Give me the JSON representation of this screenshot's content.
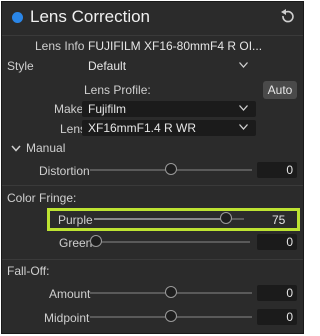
{
  "panel": {
    "title": "Lens Correction",
    "accent_color": "#2a86e8",
    "highlight_color": "#bde332",
    "icons": [
      "status-dot-icon",
      "reset-icon",
      "chevron-down-icon",
      "caret-down-icon"
    ]
  },
  "lens_info": {
    "label": "Lens Info",
    "value": "FUJIFILM XF16-80mmF4 R OI..."
  },
  "style": {
    "label": "Style",
    "value": "Default"
  },
  "lens_profile": {
    "label": "Lens Profile:",
    "auto_label": "Auto",
    "make_label": "Make",
    "make_value": "Fujifilm",
    "lens_label": "Lens",
    "lens_value": "XF16mmF1.4 R WR"
  },
  "manual": {
    "label": "Manual",
    "distortion_label": "Distortion",
    "distortion_value": "0",
    "distortion_level": 0.5
  },
  "color_fringe": {
    "label": "Color Fringe:",
    "purple_label": "Purple",
    "purple_value": "75",
    "purple_level": 0.88,
    "green_label": "Green",
    "green_value": "0",
    "green_level": 0.0
  },
  "fall_off": {
    "label": "Fall-Off:",
    "amount_label": "Amount",
    "amount_value": "0",
    "amount_level": 0.5,
    "midpoint_label": "Midpoint",
    "midpoint_value": "0",
    "midpoint_level": 0.5
  }
}
